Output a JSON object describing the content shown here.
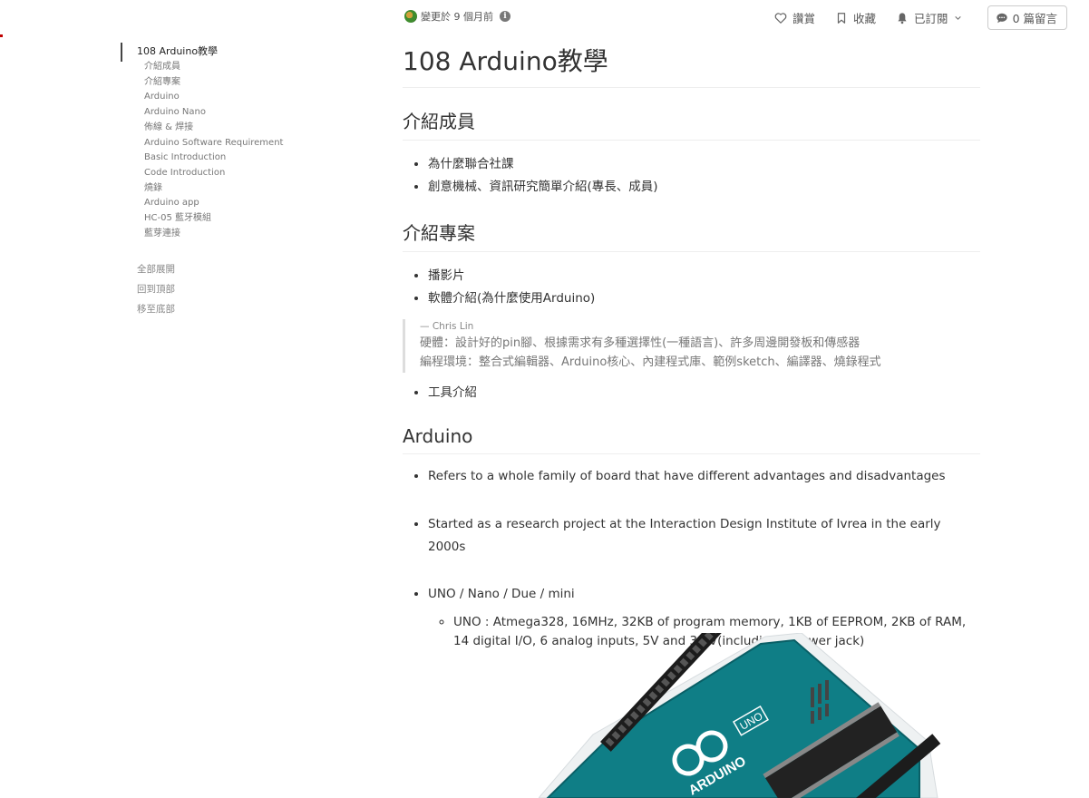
{
  "topbar": {
    "updated_text": "變更於 9 個月前",
    "praise_label": "讚賞",
    "bookmark_label": "收藏",
    "subscribe_label": "已訂閱",
    "comments_label": "0 篇留言"
  },
  "toc": {
    "title": "108 Arduino教學",
    "items": [
      "介紹成員",
      "介紹專案",
      "Arduino",
      "Arduino Nano",
      "佈線 & 焊接",
      "Arduino Software Requirement",
      "Basic Introduction",
      "Code Introduction",
      "燒錄",
      "Arduino app",
      "HC-05 藍牙模組",
      "藍芽連接"
    ],
    "expand_all": "全部展開",
    "back_to_top": "回到頂部",
    "go_to_bottom": "移至底部"
  },
  "content": {
    "title": "108 Arduino教學",
    "section1": {
      "heading": "介紹成員",
      "items": [
        "為什麼聯合社課",
        "創意機械、資訊研究簡單介紹(專長、成員)"
      ]
    },
    "section2": {
      "heading": "介紹專案",
      "items": [
        "播影片",
        "軟體介紹(為什麼使用Arduino)"
      ],
      "quote": {
        "author": "— Chris Lin",
        "line1": "硬體：設計好的pin腳、根據需求有多種選擇性(一種語言)、許多周邊開發板和傳感器",
        "line2": "編程環境：整合式編輯器、Arduino核心、內建程式庫、範例sketch、編譯器、燒錄程式"
      },
      "item3": "工具介紹"
    },
    "section3": {
      "heading": "Arduino",
      "items": [
        "Refers to a whole family of board that have different advantages and disadvantages",
        "Started as a research project at the Interaction Design Institute of Ivrea in the early 2000s",
        "UNO / Nano / Due / mini"
      ],
      "sub_items": [
        "UNO : Atmega328, 16MHz, 32KB of program memory, 1KB of EEPROM, 2KB of RAM, 14 digital I/O, 6 analog inputs, 5V and 3.3V(including a power jack)"
      ]
    },
    "image_text": {
      "board_logo": "ARDUINO",
      "board_model": "UNO"
    }
  },
  "colors": {
    "text": "#333333",
    "muted": "#777777",
    "board": "#0f7e86"
  }
}
